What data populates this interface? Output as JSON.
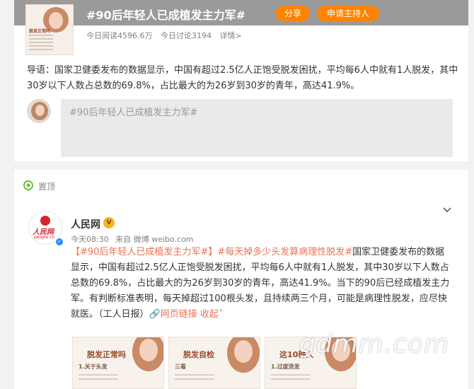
{
  "topic": {
    "title": "#90后年轻人已成植发主力军#",
    "share_label": "分享",
    "host_label": "申请主持人",
    "cover_title": "脱发正常吗",
    "read_count": "今日阅读4596.6万",
    "discuss_count": "今日讨论3194",
    "details_label": "详情>",
    "intro": "导语：国家卫健委发布的数据显示，中国有超过2.5亿人正饱受脱发困扰，平均每6人中就有1人脱发，其中30岁以下人数占总数的69.8%，占比最大的为26岁到30岁的青年，高达41.9%。",
    "post_box_text": "#90后年轻人已成植发主力军#"
  },
  "feed": {
    "pin_label": "置顶",
    "author_name": "人民网",
    "avatar_logo": "人民网",
    "avatar_sub": "people.cn",
    "vip_glyph": "V",
    "post_time": "今天08:30",
    "post_source": "来自 微博 weibo.com",
    "tag1": "【#90后年轻人已成植发主力军#】",
    "tag2": "#每天掉多少头发算病理性脱发#",
    "body": "国家卫健委发布的数据显示，中国有超过2.5亿人正饱受脱发困扰，平均每6人中就有1人脱发，其中30岁以下人数占总数的69.8%，占比最大的为26岁到30岁的青年，高达41.9%。当下的90后已经成植发主力军。有判断标准表明，每天掉超过100根头发，且持续两三个月，可能是病理性脱发，应尽快就医。（工人日报）",
    "link_label": "网页链接",
    "collapse_label": "收起",
    "thumbnails": [
      {
        "title": "脱发正常吗",
        "sub": "1.关于头发"
      },
      {
        "title": "脱发自检",
        "sub": "三看"
      },
      {
        "title": "这10种人",
        "sub": "1.过度烫发"
      }
    ]
  },
  "watermark": "gdmm.com",
  "colors": {
    "accent": "#ff8200",
    "link": "#eb7350",
    "banner": "#9a9a9a"
  }
}
